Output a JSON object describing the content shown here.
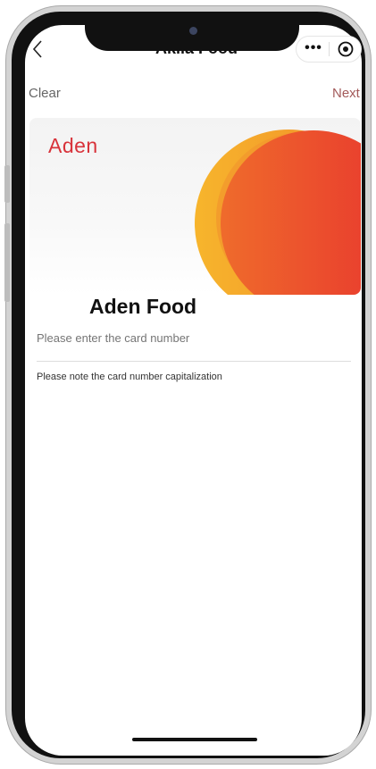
{
  "nav": {
    "title": "Akila Food",
    "back_icon": "chevron-left-icon",
    "more_icon": "more-dots-icon",
    "more_glyph": "•••",
    "close_icon": "target-circle-icon"
  },
  "actions": {
    "clear": "Clear",
    "next": "Next"
  },
  "banner": {
    "logo_text": "Aden",
    "title": "Aden Food",
    "colors": {
      "orange": "#f5a623",
      "red": "#e8382e",
      "logo": "#d8323a"
    }
  },
  "form": {
    "card_number_placeholder": "Please enter the card number",
    "hint": "Please note the card number capitalization"
  }
}
